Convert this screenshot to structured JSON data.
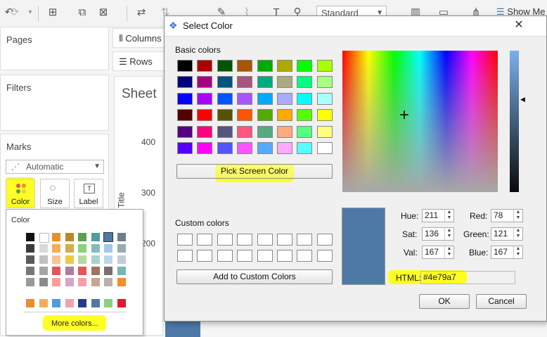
{
  "toolbar": {
    "view_mode": "Standard",
    "show_me": "Show Me"
  },
  "panels": {
    "pages": "Pages",
    "filters": "Filters",
    "marks": "Marks"
  },
  "shelves": {
    "columns": "Columns",
    "rows": "Rows"
  },
  "marks": {
    "type_select": "Automatic",
    "buttons": {
      "color": "Color",
      "size": "Size",
      "label": "Label"
    }
  },
  "sheet": {
    "title": "Sheet",
    "axis_title": "of Title",
    "ticks": [
      "400",
      "300",
      "200"
    ]
  },
  "color_popup": {
    "title": "Color",
    "more_colors": "More colors..."
  },
  "dialog": {
    "title": "Select Color",
    "basic_colors_label": "Basic colors",
    "custom_colors_label": "Custom colors",
    "pick_screen_color": "Pick Screen Color",
    "add_custom": "Add to Custom Colors",
    "fields": {
      "hue_label": "Hue:",
      "hue": "211",
      "sat_label": "Sat:",
      "sat": "136",
      "val_label": "Val:",
      "val": "167",
      "red_label": "Red:",
      "red": "78",
      "green_label": "Green:",
      "green": "121",
      "blue_label": "Blue:",
      "blue": "167",
      "html_label": "HTML:",
      "html": "#4e79a7"
    },
    "ok": "OK",
    "cancel": "Cancel",
    "selected_color": "#4e79a7",
    "basic_colors": [
      [
        "#000000",
        "#aa0000",
        "#005500",
        "#aa5500",
        "#00aa00",
        "#aaaa00",
        "#00ff00",
        "#aaff00"
      ],
      [
        "#00007f",
        "#aa007f",
        "#00557f",
        "#aa557f",
        "#00aa7f",
        "#aaaa7f",
        "#00ff7f",
        "#aaff7f"
      ],
      [
        "#0000ff",
        "#aa00ff",
        "#0055ff",
        "#aa55ff",
        "#00aaff",
        "#aaaaff",
        "#00ffff",
        "#aaffff"
      ],
      [
        "#550000",
        "#ff0000",
        "#555500",
        "#ff5500",
        "#55aa00",
        "#ffaa00",
        "#55ff00",
        "#ffff00"
      ],
      [
        "#55007f",
        "#ff007f",
        "#55557f",
        "#ff557f",
        "#55aa7f",
        "#ffaa7f",
        "#55ff7f",
        "#ffff7f"
      ],
      [
        "#5500ff",
        "#ff00ff",
        "#5555ff",
        "#ff55ff",
        "#55aaff",
        "#ffaaff",
        "#55ffff",
        "#ffffff"
      ]
    ]
  },
  "palette_columns": [
    [
      "#111111",
      "#3a3a3a",
      "#5a5a5a",
      "#777777",
      "#999999"
    ],
    [
      "#ffffff",
      "#d9d9d9",
      "#c0c0c0",
      "#a5a5a5",
      "#8a8a8a"
    ],
    [
      "#e5902a",
      "#f2ad5b",
      "#f6c48e",
      "#e15759",
      "#ff9d9a"
    ],
    [
      "#b88a2a",
      "#d4ab4e",
      "#edc948",
      "#b07aa1",
      "#d4a6c8"
    ],
    [
      "#59a14f",
      "#8cd17d",
      "#b6d99c",
      "#e15759",
      "#f1a2a9"
    ],
    [
      "#4e9f99",
      "#86bcb6",
      "#a9d2cc",
      "#9c755f",
      "#c9a58f"
    ],
    [
      "#4e79a7",
      "#a0cbe8",
      "#bcd6ee",
      "#79706e",
      "#bab0ac"
    ],
    [
      "#6b7f8e",
      "#9aa9b4",
      "#c3ccd3",
      "#76b7b2",
      "#f28e2b"
    ]
  ],
  "palette_bottom": [
    "#e5902a",
    "#f2ad5b",
    "#4e9fd8",
    "#f1a2a9",
    "#2a3a8a",
    "#4e79a7",
    "#8cd17d",
    "#e3172f"
  ]
}
